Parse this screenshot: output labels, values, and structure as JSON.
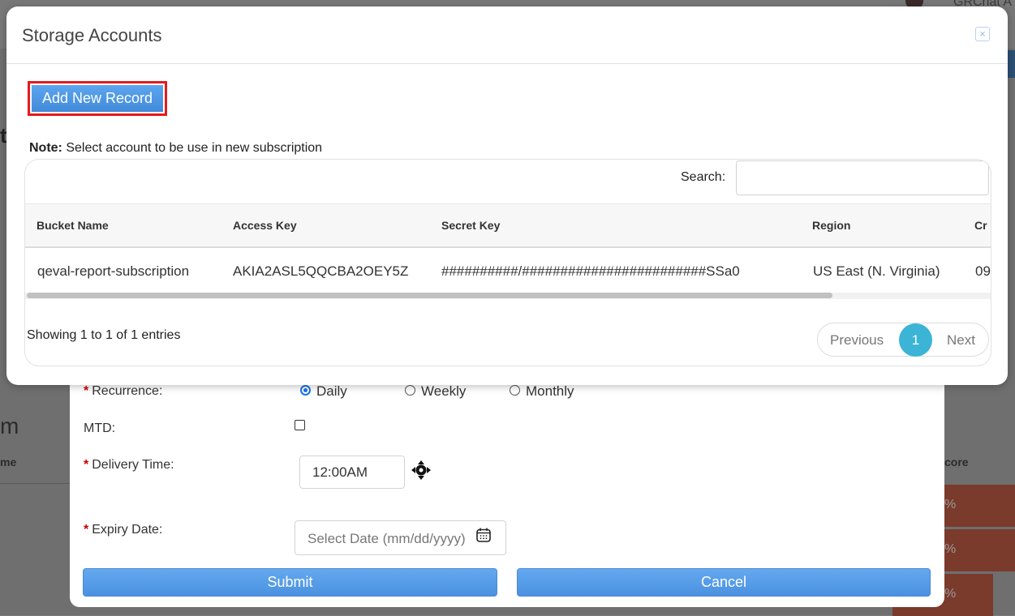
{
  "background": {
    "top_user_text": "GRChat A",
    "heading_letter": "t",
    "section_letter": "m",
    "column_partial": "me",
    "score_partial": "core",
    "pct_values": [
      "%",
      "%",
      "%"
    ]
  },
  "form": {
    "recurrence_label": "Recurrence:",
    "recurrence_options": [
      "Daily",
      "Weekly",
      "Monthly"
    ],
    "recurrence_selected": "Daily",
    "mtd_label": "MTD:",
    "delivery_time_label": "Delivery Time:",
    "delivery_time_value": "12:00AM",
    "expiry_date_label": "Expiry Date:",
    "expiry_date_placeholder": "Select Date (mm/dd/yyyy)",
    "required_marker": "*",
    "submit_label": "Submit",
    "cancel_label": "Cancel"
  },
  "modal": {
    "title": "Storage Accounts",
    "close_glyph": "×",
    "add_button_label": "Add New Record",
    "note_bold": "Note:",
    "note_text": " Select account to be use in new subscription",
    "search_label": "Search:",
    "search_value": "",
    "columns": [
      "Bucket Name",
      "Access Key",
      "Secret Key",
      "Region",
      "Cr"
    ],
    "rows": [
      {
        "bucket_name": "qeval-report-subscription",
        "access_key": "AKIA2ASL5QQCBA2OEY5Z",
        "secret_key": "##########/########################SSa0",
        "region": "US East (N. Virginia)",
        "created": "09"
      }
    ],
    "info_text": "Showing 1 to 1 of 1 entries",
    "pager": {
      "previous": "Previous",
      "current_page": "1",
      "next": "Next"
    }
  },
  "colors": {
    "primary_button": "#4a91e0",
    "highlight_border": "#e41b1b",
    "active_page": "#3bb4d6",
    "required_star": "#cc0000"
  }
}
